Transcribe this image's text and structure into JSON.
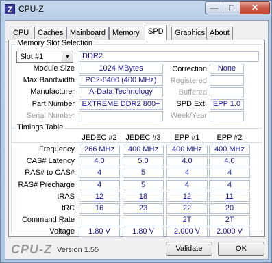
{
  "window": {
    "title": "CPU-Z",
    "icon_letter": "Z"
  },
  "tabs": [
    {
      "label": "CPU"
    },
    {
      "label": "Caches"
    },
    {
      "label": "Mainboard"
    },
    {
      "label": "Memory"
    },
    {
      "label": "SPD"
    },
    {
      "label": "Graphics"
    },
    {
      "label": "About"
    }
  ],
  "slot": {
    "group_title": "Memory Slot Selection",
    "selected_slot": "Slot #1",
    "type": "DDR2",
    "module_size_label": "Module Size",
    "module_size": "1024 MBytes",
    "max_bandwidth_label": "Max Bandwidth",
    "max_bandwidth": "PC2-6400 (400 MHz)",
    "manufacturer_label": "Manufacturer",
    "manufacturer": "A-Data Technology",
    "part_number_label": "Part Number",
    "part_number": "EXTREME DDR2 800+",
    "serial_number_label": "Serial Number",
    "serial_number": "",
    "correction_label": "Correction",
    "correction": "None",
    "registered_label": "Registered",
    "registered": "",
    "buffered_label": "Buffered",
    "buffered": "",
    "spd_ext_label": "SPD Ext.",
    "spd_ext": "EPP 1.0",
    "week_year_label": "Week/Year",
    "week_year": ""
  },
  "timings": {
    "group_title": "Timings Table",
    "columns": [
      "JEDEC #2",
      "JEDEC #3",
      "EPP #1",
      "EPP #2"
    ],
    "rows": [
      {
        "label": "Frequency",
        "values": [
          "266 MHz",
          "400 MHz",
          "400 MHz",
          "400 MHz"
        ]
      },
      {
        "label": "CAS# Latency",
        "values": [
          "4.0",
          "5.0",
          "4.0",
          "4.0"
        ]
      },
      {
        "label": "RAS# to CAS#",
        "values": [
          "4",
          "5",
          "4",
          "4"
        ]
      },
      {
        "label": "RAS# Precharge",
        "values": [
          "4",
          "5",
          "4",
          "4"
        ]
      },
      {
        "label": "tRAS",
        "values": [
          "12",
          "18",
          "12",
          "11"
        ]
      },
      {
        "label": "tRC",
        "values": [
          "16",
          "23",
          "22",
          "20"
        ]
      },
      {
        "label": "Command Rate",
        "values": [
          "",
          "",
          "2T",
          "2T"
        ]
      },
      {
        "label": "Voltage",
        "values": [
          "1.80 V",
          "1.80 V",
          "2.000 V",
          "2.000 V"
        ]
      }
    ]
  },
  "footer": {
    "brand": "CPU-Z",
    "version": "Version 1.55",
    "validate_label": "Validate",
    "ok_label": "OK"
  },
  "titlebar_buttons": {
    "minimize": "—",
    "maximize": "□",
    "close": "✕"
  }
}
